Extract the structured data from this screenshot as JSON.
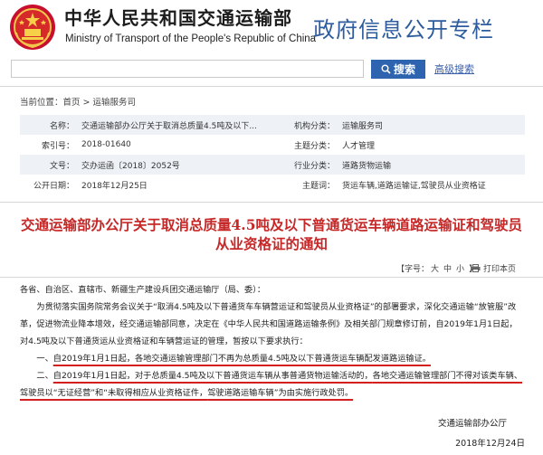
{
  "header": {
    "cn_title": "中华人民共和国交通运输部",
    "en_title": "Ministry of Transport of the People's Republic of China",
    "column_title": "政府信息公开专栏"
  },
  "search": {
    "placeholder": "",
    "button_label": "搜索",
    "advanced_label": "高级搜索"
  },
  "breadcrumb": {
    "prefix": "当前位置：",
    "home": "首页",
    "sep": " > ",
    "current": "运输服务司"
  },
  "meta": {
    "rows": [
      {
        "l1": "名称：",
        "v1": "交通运输部办公厅关于取消总质量4.5吨及以下...",
        "l2": "机构分类：",
        "v2": "运输服务司"
      },
      {
        "l1": "索引号：",
        "v1": "2018-01640",
        "l2": "主题分类：",
        "v2": "人才管理"
      },
      {
        "l1": "文号：",
        "v1": "交办运函〔2018〕2052号",
        "l2": "行业分类：",
        "v2": "道路货物运输"
      },
      {
        "l1": "公开日期：",
        "v1": "2018年12月25日",
        "l2": "主题词：",
        "v2": "货运车辆,道路运输证,驾驶员从业资格证"
      }
    ]
  },
  "document": {
    "title": "交通运输部办公厅关于取消总质量4.5吨及以下普通货运车辆道路运输证和驾驶员从业资格证的通知",
    "font_label": "【字号：",
    "font_large": "大",
    "font_medium": "中",
    "font_small": "小",
    "font_end": "】",
    "print_label": "打印本页",
    "salutation": "各省、自治区、直辖市、新疆生产建设兵团交通运输厅（局、委）：",
    "para1": "为贯彻落实国务院常务会议关于“取消4.5吨及以下普通货车车辆营运证和驾驶员从业资格证”的部署要求，深化交通运输“放管服”改革，促进物流业降本增效，经交通运输部同意，决定在《中华人民共和国道路运输条例》及相关部门规章修订前，自2019年1月1日起，对4.5吨及以下普通货运从业资格证和车辆营运证的管理，暂按以下要求执行：",
    "item1_plain": "一、",
    "item1_ul": "自2019年1月1日起，各地交通运输管理部门不再为总质量4.5吨及以下普通货运车辆配发道路运输证。",
    "item2_plain": "二、",
    "item2_ul1": "自2019年1月1日起，对于总质量4.5吨及以下普通货运车辆从事普通货物运输活动的，",
    "item2_ul2": "各地交通运输管理部门不得对该类车辆、驾驶员以“无证经营”和“未取得相应从业资格证件，",
    "item2_ul3": "驾驶道路运输车辆”为由实施行政处罚。",
    "signature": "交通运输部办公厅",
    "date": "2018年12月24日"
  },
  "colors": {
    "brand_blue": "#2e5c9e",
    "title_red": "#c62828",
    "underline_red": "#d41f1f"
  }
}
